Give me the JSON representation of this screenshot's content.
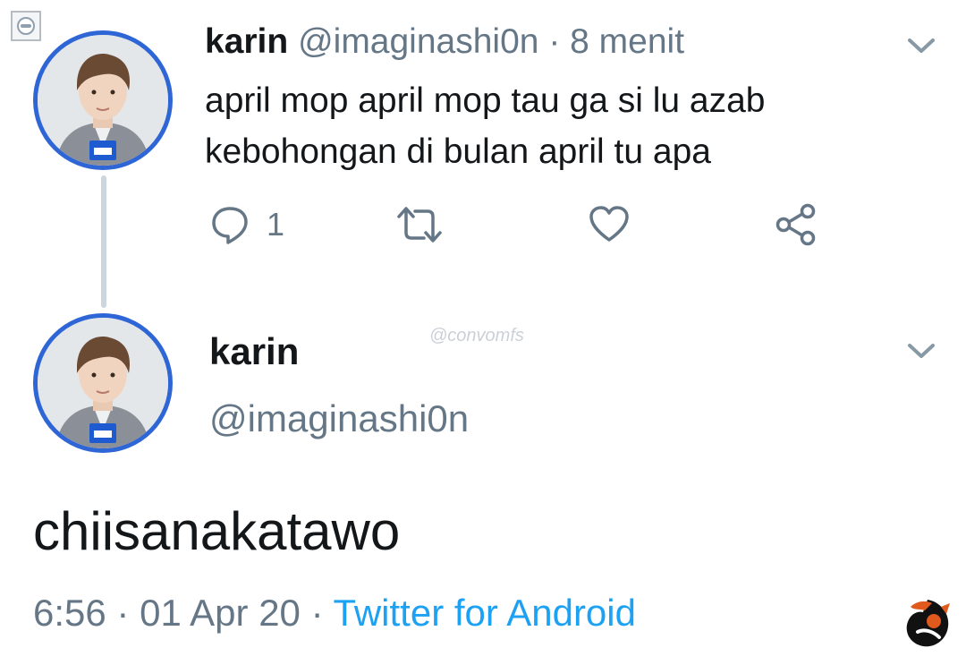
{
  "parent_tweet": {
    "name": "karin",
    "handle": "@imaginashi0n",
    "separator": "·",
    "time_ago": "8 menit",
    "text_lines": [
      "april mop april mop tau ga si lu azab",
      "kebohongan di bulan april tu apa"
    ],
    "reply_count": "1",
    "icons": {
      "reply": "reply-icon",
      "retweet": "retweet-icon",
      "like": "like-icon",
      "share": "share-icon",
      "menu": "chevron-down-icon"
    }
  },
  "main_tweet": {
    "name": "karin",
    "handle": "@imaginashi0n",
    "text": "chiisanakatawo",
    "time": "6:56",
    "separator": "·",
    "date": "01 Apr 20",
    "source": "Twitter for Android"
  },
  "watermark": "@convomfs",
  "colors": {
    "avatar_ring": "#2f66d6",
    "muted": "#657786",
    "link": "#1da1f2",
    "thread_line": "#cdd5dd"
  }
}
